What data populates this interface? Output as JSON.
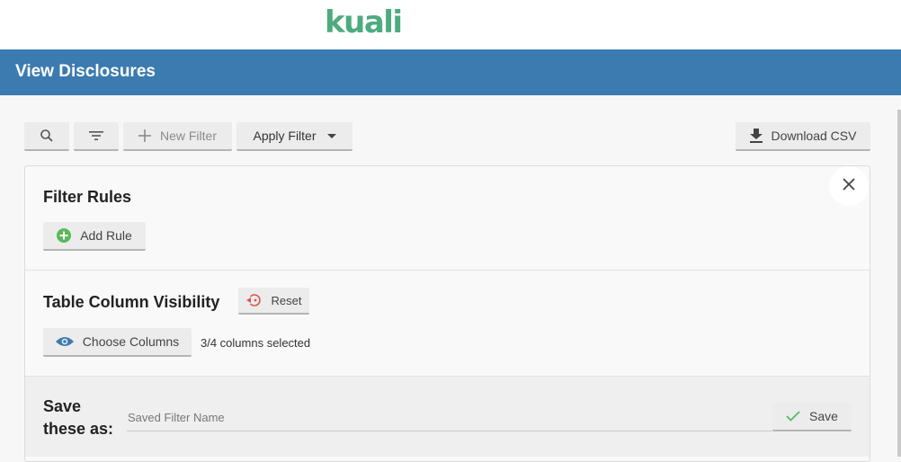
{
  "header": {
    "logo_text": "kuali",
    "title": "View Disclosures"
  },
  "toolbar": {
    "search_icon": "search-icon",
    "filter_icon": "filter-lines-icon",
    "new_filter_label": "New Filter",
    "apply_filter_label": "Apply Filter",
    "download_csv_label": "Download CSV"
  },
  "filter_panel": {
    "filter_rules_heading": "Filter Rules",
    "add_rule_label": "Add Rule",
    "column_visibility_heading": "Table Column Visibility",
    "reset_label": "Reset",
    "choose_columns_label": "Choose Columns",
    "columns_selected_text": "3/4 columns selected",
    "save_as_label": "Save these as:",
    "saved_filter_name_placeholder": "Saved Filter Name",
    "saved_filter_name_value": "",
    "save_label": "Save"
  },
  "colors": {
    "brand_green": "#4dab7f",
    "title_bar_blue": "#3c7bb0",
    "add_icon_green": "#5cb85c",
    "reset_icon_red": "#d9534f",
    "eye_icon_blue": "#3c7bb0",
    "check_icon_green": "#5cb85c"
  }
}
